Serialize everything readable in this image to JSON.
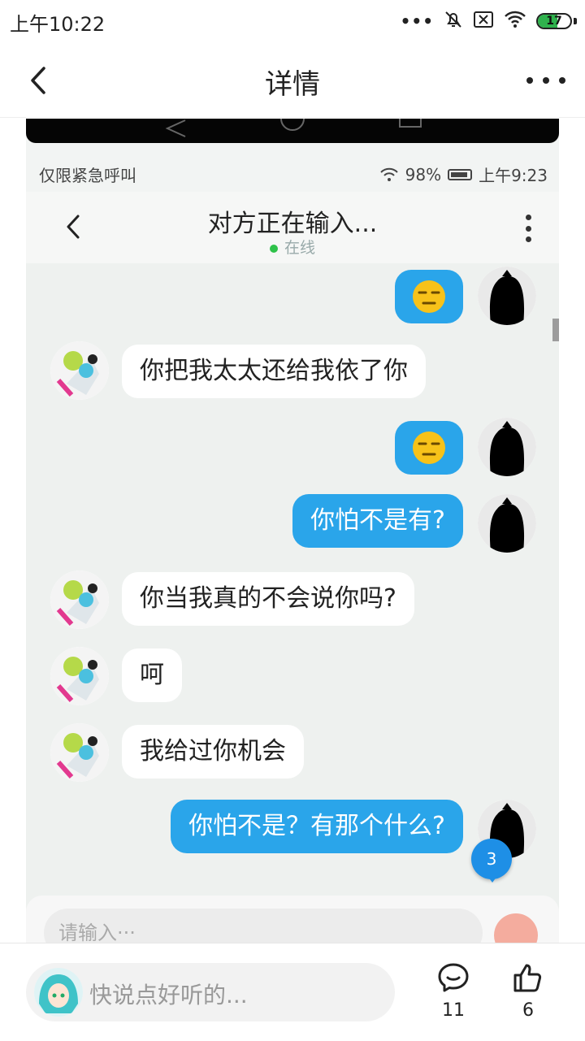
{
  "status_bar": {
    "time": "上午10:22",
    "battery": "17"
  },
  "header": {
    "title": "详情"
  },
  "screenshot": {
    "inner_status": {
      "left_text": "仅限紧急呼叫",
      "battery_text": "98%",
      "time": "上午9:23"
    },
    "chat_header": {
      "title": "对方正在输入...",
      "status": "在线"
    },
    "messages": [
      {
        "side": "right",
        "type": "emoji"
      },
      {
        "side": "left",
        "text": "你把我太太还给我依了你"
      },
      {
        "side": "right",
        "type": "emoji"
      },
      {
        "side": "right",
        "text": "你怕不是有?"
      },
      {
        "side": "left",
        "text": "你当我真的不会说你吗?"
      },
      {
        "side": "left",
        "text": "呵"
      },
      {
        "side": "left",
        "text": "我给过你机会"
      },
      {
        "side": "right",
        "text": "你怕不是？有那个什么?"
      }
    ],
    "unread_count": "3",
    "input_placeholder": "请输入···"
  },
  "bottom_bar": {
    "comment_placeholder": "快说点好听的...",
    "comment_count": "11",
    "like_count": "6"
  },
  "colors": {
    "bubble_blue": "#2aa5ea",
    "online_green": "#2ec24a",
    "battery_green": "#2fb24d"
  }
}
